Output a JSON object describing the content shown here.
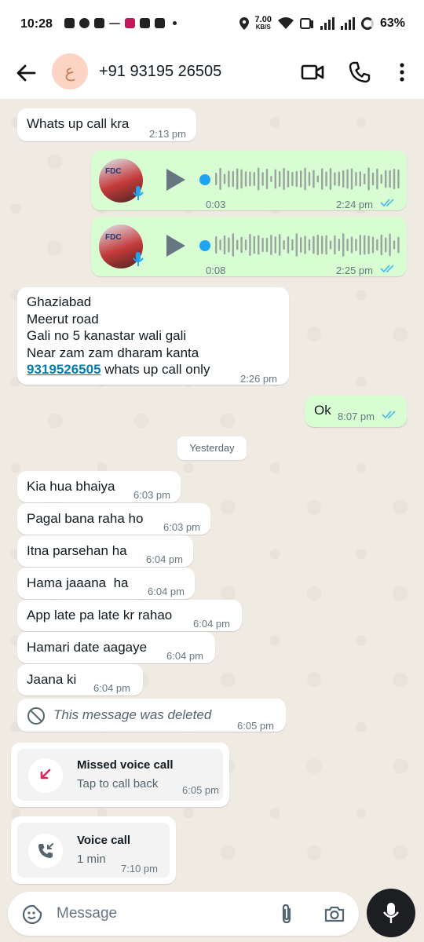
{
  "status_bar": {
    "time": "10:28",
    "net_speed_value": "7.00",
    "net_speed_unit": "KB/S",
    "battery": "63%"
  },
  "header": {
    "avatar_letter": "ع",
    "contact_name": "+91 93195 26505"
  },
  "messages": {
    "m1": {
      "text": "Whats up call kra",
      "time": "2:13 pm"
    },
    "voice1": {
      "thumb_label": "FDC",
      "duration": "0:03",
      "time": "2:24 pm"
    },
    "voice2": {
      "thumb_label": "FDC",
      "duration": "0:08",
      "time": "2:25 pm"
    },
    "address": {
      "line1": "Ghaziabad",
      "line2": "Meerut road",
      "line3": "Gali no 5 kanastar wali gali",
      "line4": "Near zam zam dharam kanta",
      "phone_link": "9319526505",
      "line5_rest": " whats up call only",
      "time": "2:26 pm"
    },
    "ok": {
      "text": "Ok",
      "time": "8:07 pm"
    },
    "date_divider": "Yesterday",
    "m2": {
      "text": "Kia hua bhaiya",
      "time": "6:03 pm"
    },
    "m3": {
      "text": "Pagal bana raha ho",
      "time": "6:03 pm"
    },
    "m4": {
      "text": "Itna parsehan ha",
      "time": "6:04 pm"
    },
    "m5": {
      "text": "Hama jaaana  ha",
      "time": "6:04 pm"
    },
    "m6": {
      "text": "App late pa late kr rahao",
      "time": "6:04 pm"
    },
    "m7": {
      "text": "Hamari date aagaye",
      "time": "6:04 pm"
    },
    "m8": {
      "text": "Jaana ki",
      "time": "6:04 pm"
    },
    "deleted": {
      "text": "This message was deleted",
      "time": "6:05 pm"
    },
    "missed_call": {
      "title": "Missed voice call",
      "subtitle": "Tap to call back",
      "time": "6:05 pm"
    },
    "voice_call": {
      "title": "Voice call",
      "subtitle": "1 min",
      "time": "7:10 pm"
    }
  },
  "composer": {
    "placeholder": "Message"
  },
  "colors": {
    "incoming_bubble": "#ffffff",
    "outgoing_bubble": "#d9fdd3",
    "read_ticks": "#53bdeb",
    "link": "#027eb5",
    "missed_call": "#e0245e"
  }
}
